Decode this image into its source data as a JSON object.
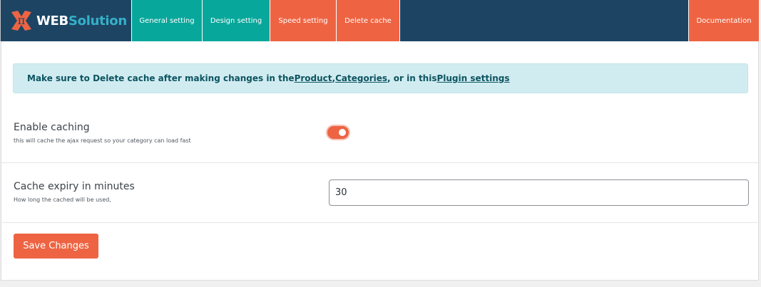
{
  "brand": {
    "name_part1": "WEB",
    "name_part2": "Solution",
    "logo_icon": "pi-x-logo-icon",
    "colors": {
      "navy": "#1d4563",
      "teal": "#08a79b",
      "orange": "#ee6443",
      "accent": "#35b0c9"
    }
  },
  "nav": {
    "tabs": [
      {
        "label": "General setting"
      },
      {
        "label": "Design setting"
      },
      {
        "label": "Speed setting"
      },
      {
        "label": "Delete cache"
      }
    ],
    "documentation_label": "Documentation"
  },
  "notice": {
    "text_before": "Make sure to Delete cache after making changes in the ",
    "link_product": "Product",
    "sep1": ", ",
    "link_categories": "Categories",
    "text_middle": ", or in this ",
    "link_plugin": "Plugin settings"
  },
  "settings": {
    "enable_caching": {
      "title": "Enable caching",
      "description": "this will cache the ajax request so your category can load fast",
      "enabled": true
    },
    "cache_expiry": {
      "title": "Cache expiry in minutes",
      "description": "How long the cached will be used,",
      "value": "30"
    }
  },
  "actions": {
    "save_label": "Save Changes"
  }
}
